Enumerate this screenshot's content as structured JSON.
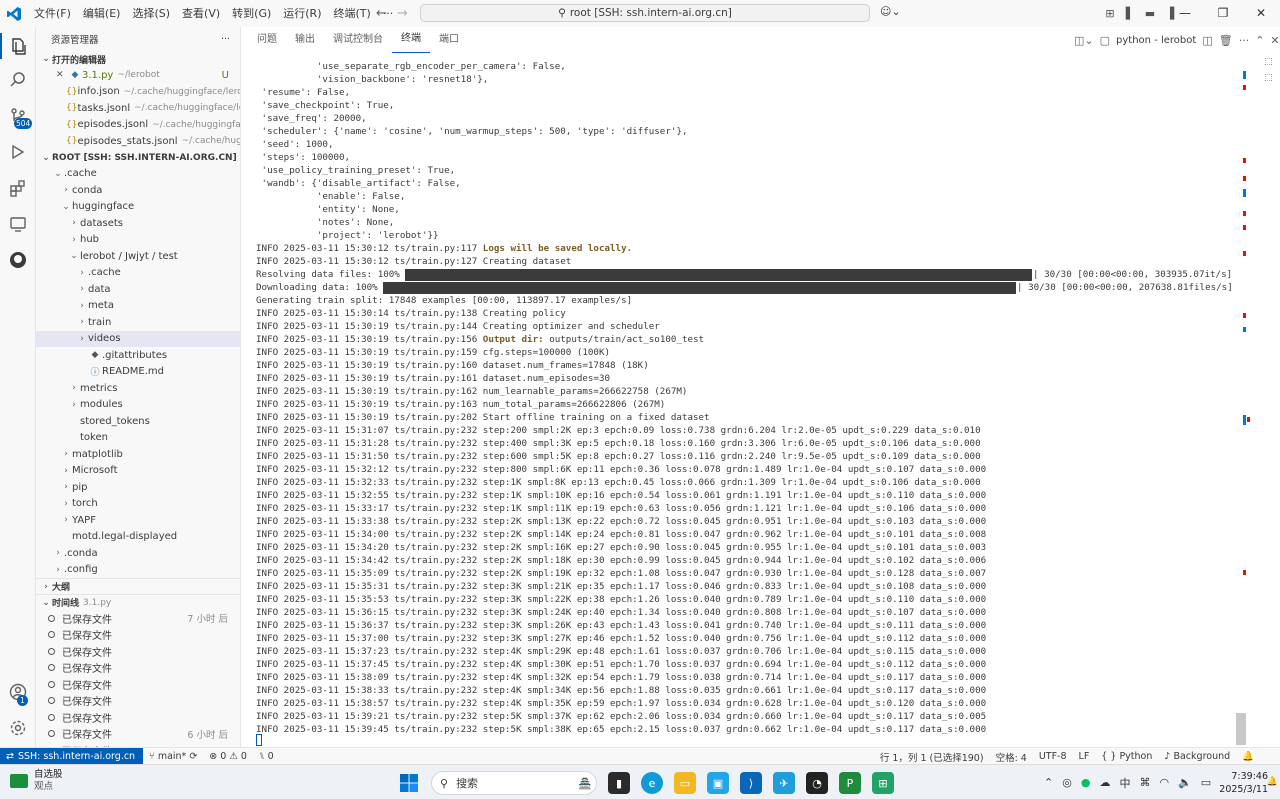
{
  "titlebar": {
    "menus": [
      "文件(F)",
      "编辑(E)",
      "选择(S)",
      "查看(V)",
      "转到(G)",
      "运行(R)",
      "终端(T)",
      "···"
    ],
    "command_center": "root [SSH: ssh.intern-ai.org.cn]"
  },
  "activitybar": {
    "scm_badge": "504",
    "account_badge": "1"
  },
  "sidebar": {
    "title": "资源管理器",
    "open_editors_label": "打开的编辑器",
    "open_editors": [
      {
        "name": "3.1.py",
        "path": "~/lerobot",
        "status": "U",
        "icon": "python-file-icon"
      },
      {
        "name": "info.json",
        "path": "~/.cache/huggingface/lerob...",
        "icon": "json-file-icon"
      },
      {
        "name": "tasks.jsonl",
        "path": "~/.cache/huggingface/ler...",
        "icon": "json-file-icon"
      },
      {
        "name": "episodes.jsonl",
        "path": "~/.cache/huggingfac...",
        "icon": "json-file-icon"
      },
      {
        "name": "episodes_stats.jsonl",
        "path": "~/.cache/huggi...",
        "icon": "json-file-icon"
      }
    ],
    "root_label": "ROOT [SSH: SSH.INTERN-AI.ORG.CN]",
    "tree": [
      {
        "label": ".cache",
        "indent": 1,
        "chev": "open"
      },
      {
        "label": "conda",
        "indent": 2,
        "chev": "closed"
      },
      {
        "label": "huggingface",
        "indent": 2,
        "chev": "open"
      },
      {
        "label": "datasets",
        "indent": 3,
        "chev": "closed"
      },
      {
        "label": "hub",
        "indent": 3,
        "chev": "closed"
      },
      {
        "label": "lerobot / Jwjyt / test",
        "indent": 3,
        "chev": "open"
      },
      {
        "label": ".cache",
        "indent": 4,
        "chev": "closed"
      },
      {
        "label": "data",
        "indent": 4,
        "chev": "closed"
      },
      {
        "label": "meta",
        "indent": 4,
        "chev": "closed"
      },
      {
        "label": "train",
        "indent": 4,
        "chev": "closed"
      },
      {
        "label": "videos",
        "indent": 4,
        "chev": "closed",
        "selected": true
      },
      {
        "label": ".gitattributes",
        "indent": 4,
        "chev": "none",
        "icon": "git-icon"
      },
      {
        "label": "README.md",
        "indent": 4,
        "chev": "none",
        "icon": "info-icon"
      },
      {
        "label": "metrics",
        "indent": 3,
        "chev": "closed"
      },
      {
        "label": "modules",
        "indent": 3,
        "chev": "closed"
      },
      {
        "label": "stored_tokens",
        "indent": 3,
        "chev": "none"
      },
      {
        "label": "token",
        "indent": 3,
        "chev": "none"
      },
      {
        "label": "matplotlib",
        "indent": 2,
        "chev": "closed"
      },
      {
        "label": "Microsoft",
        "indent": 2,
        "chev": "closed"
      },
      {
        "label": "pip",
        "indent": 2,
        "chev": "closed"
      },
      {
        "label": "torch",
        "indent": 2,
        "chev": "closed"
      },
      {
        "label": "YAPF",
        "indent": 2,
        "chev": "closed"
      },
      {
        "label": "motd.legal-displayed",
        "indent": 2,
        "chev": "none"
      },
      {
        "label": ".conda",
        "indent": 1,
        "chev": "closed"
      },
      {
        "label": ".config",
        "indent": 1,
        "chev": "closed"
      }
    ],
    "outline_label": "大纲",
    "timeline_label": "时间线",
    "timeline_file": "3.1.py",
    "timeline": [
      {
        "label": "已保存文件",
        "time": "7 小时 后"
      },
      {
        "label": "已保存文件",
        "time": ""
      },
      {
        "label": "已保存文件",
        "time": ""
      },
      {
        "label": "已保存文件",
        "time": ""
      },
      {
        "label": "已保存文件",
        "time": ""
      },
      {
        "label": "已保存文件",
        "time": ""
      },
      {
        "label": "已保存文件",
        "time": ""
      },
      {
        "label": "已保存文件",
        "time": "6 小时 后"
      },
      {
        "label": "已保存文件",
        "time": ""
      }
    ]
  },
  "panel": {
    "tabs": [
      "问题",
      "输出",
      "调试控制台",
      "终端",
      "端口"
    ],
    "active_tab": 3,
    "terminal_name": "python - lerobot"
  },
  "terminal": {
    "lines": [
      {
        "text": "           'use_separate_rgb_encoder_per_camera': False,"
      },
      {
        "text": "           'vision_backbone': 'resnet18'},"
      },
      {
        "text": " 'resume': False,"
      },
      {
        "text": " 'save_checkpoint': True,"
      },
      {
        "text": " 'save_freq': 20000,"
      },
      {
        "text": " 'scheduler': {'name': 'cosine', 'num_warmup_steps': 500, 'type': 'diffuser'},"
      },
      {
        "text": " 'seed': 1000,"
      },
      {
        "text": " 'steps': 100000,"
      },
      {
        "text": " 'use_policy_training_preset': True,"
      },
      {
        "text": " 'wandb': {'disable_artifact': False,"
      },
      {
        "text": "           'enable': False,"
      },
      {
        "text": "           'entity': None,"
      },
      {
        "text": "           'notes': None,"
      },
      {
        "text": "           'project': 'lerobot'}}"
      },
      {
        "pre": "INFO 2025-03-11 15:30:12 ts/train.py:117 ",
        "hl": "Logs will be saved locally.",
        "post": ""
      },
      {
        "text": "INFO 2025-03-11 15:30:12 ts/train.py:127 Creating dataset"
      },
      {
        "text": "Resolving data files: 100%"
      },
      {
        "text": "Downloading data: 100%"
      },
      {
        "text": "Generating train split: 17848 examples [00:00, 113897.17 examples/s]"
      },
      {
        "text": "INFO 2025-03-11 15:30:14 ts/train.py:138 Creating policy"
      },
      {
        "text": "INFO 2025-03-11 15:30:19 ts/train.py:144 Creating optimizer and scheduler"
      },
      {
        "pre": "INFO 2025-03-11 15:30:19 ts/train.py:156 ",
        "hl": "Output dir:",
        "post": " outputs/train/act_so100_test"
      },
      {
        "text": "INFO 2025-03-11 15:30:19 ts/train.py:159 cfg.steps=100000 (100K)"
      },
      {
        "text": "INFO 2025-03-11 15:30:19 ts/train.py:160 dataset.num_frames=17848 (18K)"
      },
      {
        "text": "INFO 2025-03-11 15:30:19 ts/train.py:161 dataset.num_episodes=30"
      },
      {
        "text": "INFO 2025-03-11 15:30:19 ts/train.py:162 num_learnable_params=266622758 (267M)"
      },
      {
        "text": "INFO 2025-03-11 15:30:19 ts/train.py:163 num_total_params=266622806 (267M)"
      },
      {
        "text": "INFO 2025-03-11 15:30:19 ts/train.py:202 Start offline training on a fixed dataset"
      },
      {
        "text": "INFO 2025-03-11 15:31:07 ts/train.py:232 step:200 smpl:2K ep:3 epch:0.09 loss:0.738 grdn:6.204 lr:2.0e-05 updt_s:0.229 data_s:0.010"
      },
      {
        "text": "INFO 2025-03-11 15:31:28 ts/train.py:232 step:400 smpl:3K ep:5 epch:0.18 loss:0.160 grdn:3.306 lr:6.0e-05 updt_s:0.106 data_s:0.000"
      },
      {
        "text": "INFO 2025-03-11 15:31:50 ts/train.py:232 step:600 smpl:5K ep:8 epch:0.27 loss:0.116 grdn:2.240 lr:9.5e-05 updt_s:0.109 data_s:0.000"
      },
      {
        "text": "INFO 2025-03-11 15:32:12 ts/train.py:232 step:800 smpl:6K ep:11 epch:0.36 loss:0.078 grdn:1.489 lr:1.0e-04 updt_s:0.107 data_s:0.000"
      },
      {
        "text": "INFO 2025-03-11 15:32:33 ts/train.py:232 step:1K smpl:8K ep:13 epch:0.45 loss:0.066 grdn:1.309 lr:1.0e-04 updt_s:0.106 data_s:0.000"
      },
      {
        "text": "INFO 2025-03-11 15:32:55 ts/train.py:232 step:1K smpl:10K ep:16 epch:0.54 loss:0.061 grdn:1.191 lr:1.0e-04 updt_s:0.110 data_s:0.000"
      },
      {
        "text": "INFO 2025-03-11 15:33:17 ts/train.py:232 step:1K smpl:11K ep:19 epch:0.63 loss:0.056 grdn:1.121 lr:1.0e-04 updt_s:0.106 data_s:0.000"
      },
      {
        "text": "INFO 2025-03-11 15:33:38 ts/train.py:232 step:2K smpl:13K ep:22 epch:0.72 loss:0.045 grdn:0.951 lr:1.0e-04 updt_s:0.103 data_s:0.000"
      },
      {
        "text": "INFO 2025-03-11 15:34:00 ts/train.py:232 step:2K smpl:14K ep:24 epch:0.81 loss:0.047 grdn:0.962 lr:1.0e-04 updt_s:0.101 data_s:0.008"
      },
      {
        "text": "INFO 2025-03-11 15:34:20 ts/train.py:232 step:2K smpl:16K ep:27 epch:0.90 loss:0.045 grdn:0.955 lr:1.0e-04 updt_s:0.101 data_s:0.003"
      },
      {
        "text": "INFO 2025-03-11 15:34:42 ts/train.py:232 step:2K smpl:18K ep:30 epch:0.99 loss:0.045 grdn:0.944 lr:1.0e-04 updt_s:0.102 data_s:0.006"
      },
      {
        "text": "INFO 2025-03-11 15:35:09 ts/train.py:232 step:2K smpl:19K ep:32 epch:1.08 loss:0.047 grdn:0.930 lr:1.0e-04 updt_s:0.128 data_s:0.007"
      },
      {
        "text": "INFO 2025-03-11 15:35:31 ts/train.py:232 step:3K smpl:21K ep:35 epch:1.17 loss:0.046 grdn:0.833 lr:1.0e-04 updt_s:0.108 data_s:0.000"
      },
      {
        "text": "INFO 2025-03-11 15:35:53 ts/train.py:232 step:3K smpl:22K ep:38 epch:1.26 loss:0.040 grdn:0.789 lr:1.0e-04 updt_s:0.110 data_s:0.000"
      },
      {
        "text": "INFO 2025-03-11 15:36:15 ts/train.py:232 step:3K smpl:24K ep:40 epch:1.34 loss:0.040 grdn:0.808 lr:1.0e-04 updt_s:0.107 data_s:0.000"
      },
      {
        "text": "INFO 2025-03-11 15:36:37 ts/train.py:232 step:3K smpl:26K ep:43 epch:1.43 loss:0.041 grdn:0.740 lr:1.0e-04 updt_s:0.111 data_s:0.000"
      },
      {
        "text": "INFO 2025-03-11 15:37:00 ts/train.py:232 step:3K smpl:27K ep:46 epch:1.52 loss:0.040 grdn:0.756 lr:1.0e-04 updt_s:0.112 data_s:0.000"
      },
      {
        "text": "INFO 2025-03-11 15:37:23 ts/train.py:232 step:4K smpl:29K ep:48 epch:1.61 loss:0.037 grdn:0.706 lr:1.0e-04 updt_s:0.115 data_s:0.000"
      },
      {
        "text": "INFO 2025-03-11 15:37:45 ts/train.py:232 step:4K smpl:30K ep:51 epch:1.70 loss:0.037 grdn:0.694 lr:1.0e-04 updt_s:0.112 data_s:0.000"
      },
      {
        "text": "INFO 2025-03-11 15:38:09 ts/train.py:232 step:4K smpl:32K ep:54 epch:1.79 loss:0.038 grdn:0.714 lr:1.0e-04 updt_s:0.117 data_s:0.000"
      },
      {
        "text": "INFO 2025-03-11 15:38:33 ts/train.py:232 step:4K smpl:34K ep:56 epch:1.88 loss:0.035 grdn:0.661 lr:1.0e-04 updt_s:0.117 data_s:0.000"
      },
      {
        "text": "INFO 2025-03-11 15:38:57 ts/train.py:232 step:4K smpl:35K ep:59 epch:1.97 loss:0.034 grdn:0.628 lr:1.0e-04 updt_s:0.120 data_s:0.000"
      },
      {
        "text": "INFO 2025-03-11 15:39:21 ts/train.py:232 step:5K smpl:37K ep:62 epch:2.06 loss:0.034 grdn:0.660 lr:1.0e-04 updt_s:0.117 data_s:0.005"
      },
      {
        "text": "INFO 2025-03-11 15:39:45 ts/train.py:232 step:5K smpl:38K ep:65 epch:2.15 loss:0.037 grdn:0.662 lr:1.0e-04 updt_s:0.117 data_s:0.000"
      }
    ],
    "progress": [
      {
        "line": 16,
        "percent": 100,
        "suffix": "| 30/30 [00:00<00:00, 303935.07it/s]"
      },
      {
        "line": 17,
        "percent": 100,
        "suffix": "| 30/30 [00:00<00:00, 207638.81files/s]"
      }
    ]
  },
  "statusbar": {
    "remote": "SSH: ssh.intern-ai.org.cn",
    "branch": "main*",
    "errors": "0",
    "warnings": "0",
    "ports": "0",
    "position": "行 1，列 1 (已选择190)",
    "spaces": "空格: 4",
    "encoding": "UTF-8",
    "eol": "LF",
    "language": "Python",
    "background": "Background"
  },
  "taskbar": {
    "stock_name": "自选股",
    "stock_sub": "观点",
    "search_placeholder": "搜索",
    "ime": "中",
    "time": "7:39:46",
    "date": "2025/3/11"
  },
  "colors": {
    "accent": "#005fb8",
    "highlight_text": "#795e26",
    "untracked": "#587c0c"
  }
}
